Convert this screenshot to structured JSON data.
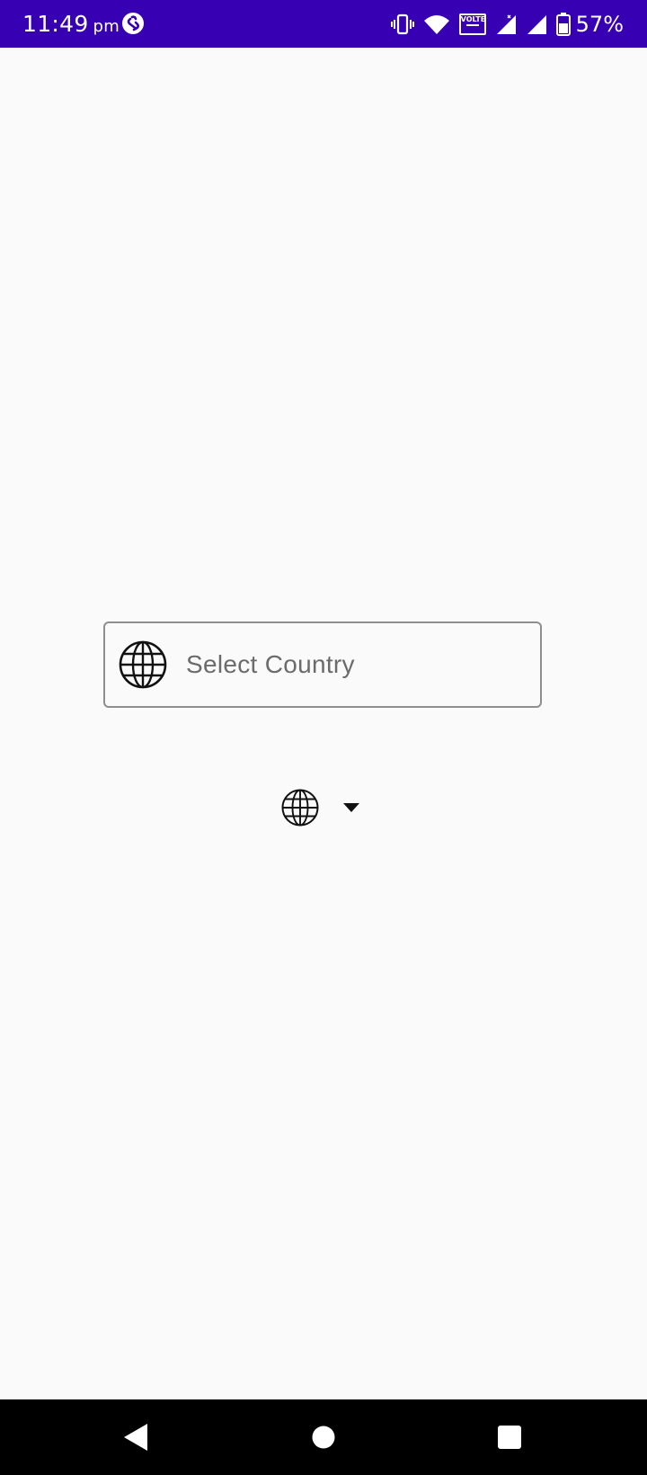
{
  "status_bar": {
    "time": "11:49",
    "time_suffix": "pm",
    "battery_percent": "57%",
    "network_label": "VOLTE",
    "background_color": "#3700b3",
    "icons": [
      "shazam-icon",
      "vibrate-icon",
      "wifi-icon",
      "volte-icon",
      "signal-icon",
      "signal-icon",
      "battery-icon"
    ]
  },
  "country_field": {
    "placeholder": "Select Country",
    "icon": "globe-icon"
  },
  "country_picker": {
    "icon": "globe-icon",
    "dropdown_icon": "caret-down-icon"
  },
  "nav_bar": {
    "buttons": [
      "back",
      "home",
      "recents"
    ]
  }
}
